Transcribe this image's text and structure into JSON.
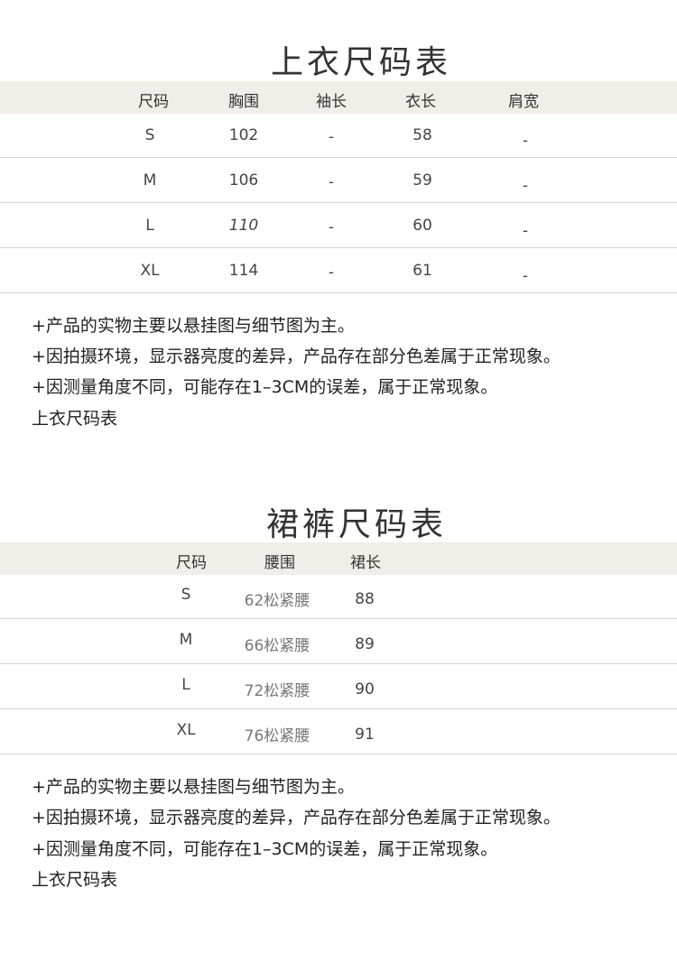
{
  "top_table": {
    "title": "上衣尺码表",
    "headers": [
      "尺码",
      "胸围",
      "袖长",
      "衣长",
      "肩宽"
    ],
    "rows": [
      [
        "S",
        "102",
        "-",
        "58",
        "-"
      ],
      [
        "M",
        "106",
        "-",
        "59",
        "-"
      ],
      [
        "L",
        "110",
        "-",
        "60",
        "-"
      ],
      [
        "XL",
        "114",
        "-",
        "61",
        "-"
      ]
    ],
    "notes": [
      "+产品的实物主要以悬挂图与细节图为主。",
      "+因拍摄环境，显示器亮度的差异，产品存在部分色差属于正常现象。",
      "+因测量角度不同，可能存在1–3CM的误差，属于正常现象。",
      "上衣尺码表"
    ]
  },
  "skirt_table": {
    "title": "裙裤尺码表",
    "headers": [
      "尺码",
      "腰围",
      "裙长"
    ],
    "rows": [
      [
        "S",
        "62松紧腰",
        "88"
      ],
      [
        "M",
        "66松紧腰",
        "89"
      ],
      [
        "L",
        "72松紧腰",
        "90"
      ],
      [
        "XL",
        "76松紧腰",
        "91"
      ]
    ],
    "notes": [
      "+产品的实物主要以悬挂图与细节图为主。",
      "+因拍摄环境，显示器亮度的差异，产品存在部分色差属于正常现象。",
      "+因测量角度不同，可能存在1–3CM的误差，属于正常现象。",
      "上衣尺码表"
    ]
  }
}
